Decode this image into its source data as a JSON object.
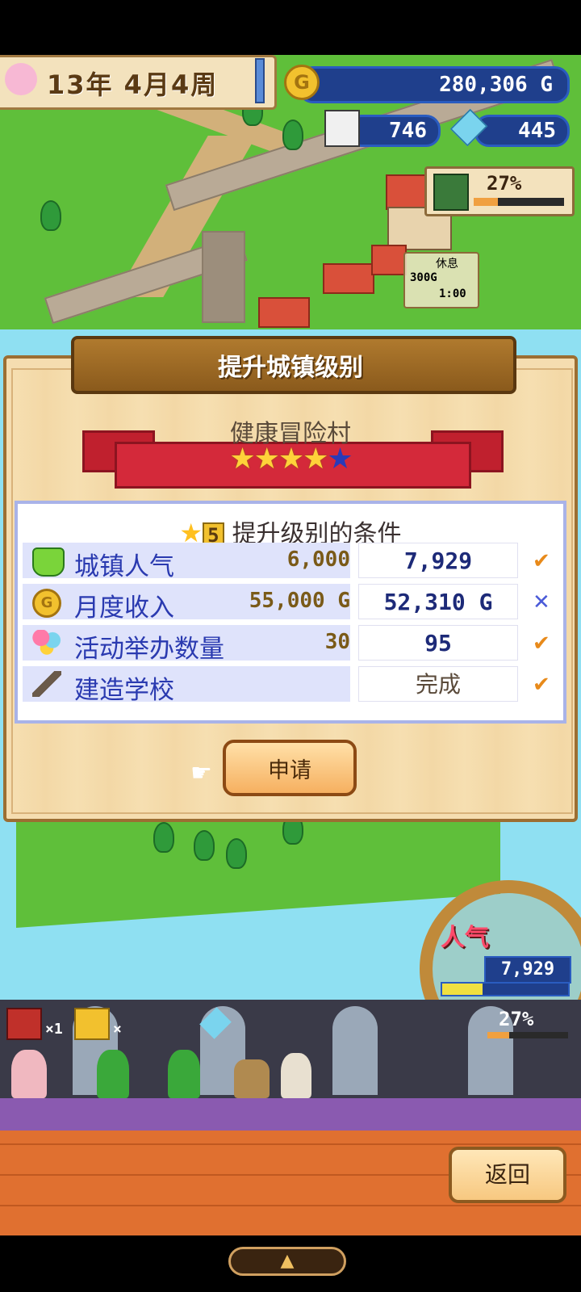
{
  "hud": {
    "date": "13年 4月4周",
    "gold": "280,306 G",
    "population": "746",
    "crystals": "445",
    "progress_pct": "27%",
    "progress_value": 0.27,
    "rest_label": "休息",
    "cost_label": "300G",
    "timer": "1:00"
  },
  "dialog": {
    "title": "提升城镇级别",
    "town_name": "健康冒险村",
    "stars_filled": "★★★★",
    "stars_empty": "★",
    "condition_title": "提升级别的条件",
    "star_level": "5",
    "conditions": [
      {
        "icon": "trophy-icon",
        "name": "城镇人气",
        "required": "6,000",
        "current": "7,929",
        "status": "✔"
      },
      {
        "icon": "gold-coin-icon",
        "name": "月度收入",
        "required": "55,000 G",
        "current": "52,310 G",
        "status": "✕"
      },
      {
        "icon": "balloons-icon",
        "name": "活动举办数量",
        "required": "30",
        "current": "95",
        "status": "✔"
      },
      {
        "icon": "hammer-icon",
        "name": "建造学校",
        "required": "",
        "current": "完成",
        "status": "✔"
      }
    ],
    "apply_label": "申请"
  },
  "popularity": {
    "label": "人气",
    "value": "7,929"
  },
  "bottom": {
    "chest_count": "×1",
    "chest2_count": "×",
    "progress_pct": "27%",
    "back_label": "返回",
    "nav_arrow": "▲"
  },
  "colors": {
    "ok": "#e88a1a",
    "fail": "#4a5ad8"
  }
}
